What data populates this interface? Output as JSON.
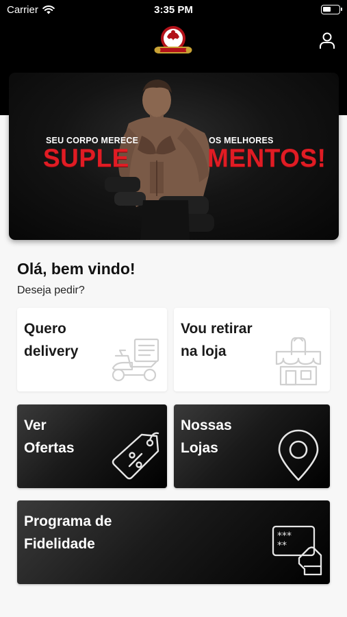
{
  "status_bar": {
    "carrier": "Carrier",
    "time": "3:35 PM"
  },
  "header": {
    "logo_icon": "brand-logo-icon",
    "user_icon": "user-icon"
  },
  "banner": {
    "tagline_left": "SEU CORPO MERECE",
    "tagline_right": "OS MELHORES",
    "headline_left": "SUPLE",
    "headline_right": "MENTOS!"
  },
  "greeting": {
    "title": "Olá, bem vindo!",
    "subtitle": "Deseja pedir?"
  },
  "cards": {
    "delivery": {
      "line1": "Quero",
      "line2": "delivery",
      "icon": "delivery-scooter-icon"
    },
    "pickup": {
      "line1": "Vou retirar",
      "line2": "na loja",
      "icon": "store-pickup-icon"
    },
    "offers": {
      "line1": "Ver",
      "line2": "Ofertas",
      "icon": "discount-tag-icon"
    },
    "stores": {
      "line1": "Nossas",
      "line2": "Lojas",
      "icon": "location-pin-icon"
    },
    "loyalty": {
      "line1": "Programa de",
      "line2": "Fidelidade",
      "icon": "loyalty-card-icon"
    }
  },
  "colors": {
    "accent_red": "#e01c24",
    "header_bg": "#000000",
    "page_bg": "#f7f7f7"
  }
}
